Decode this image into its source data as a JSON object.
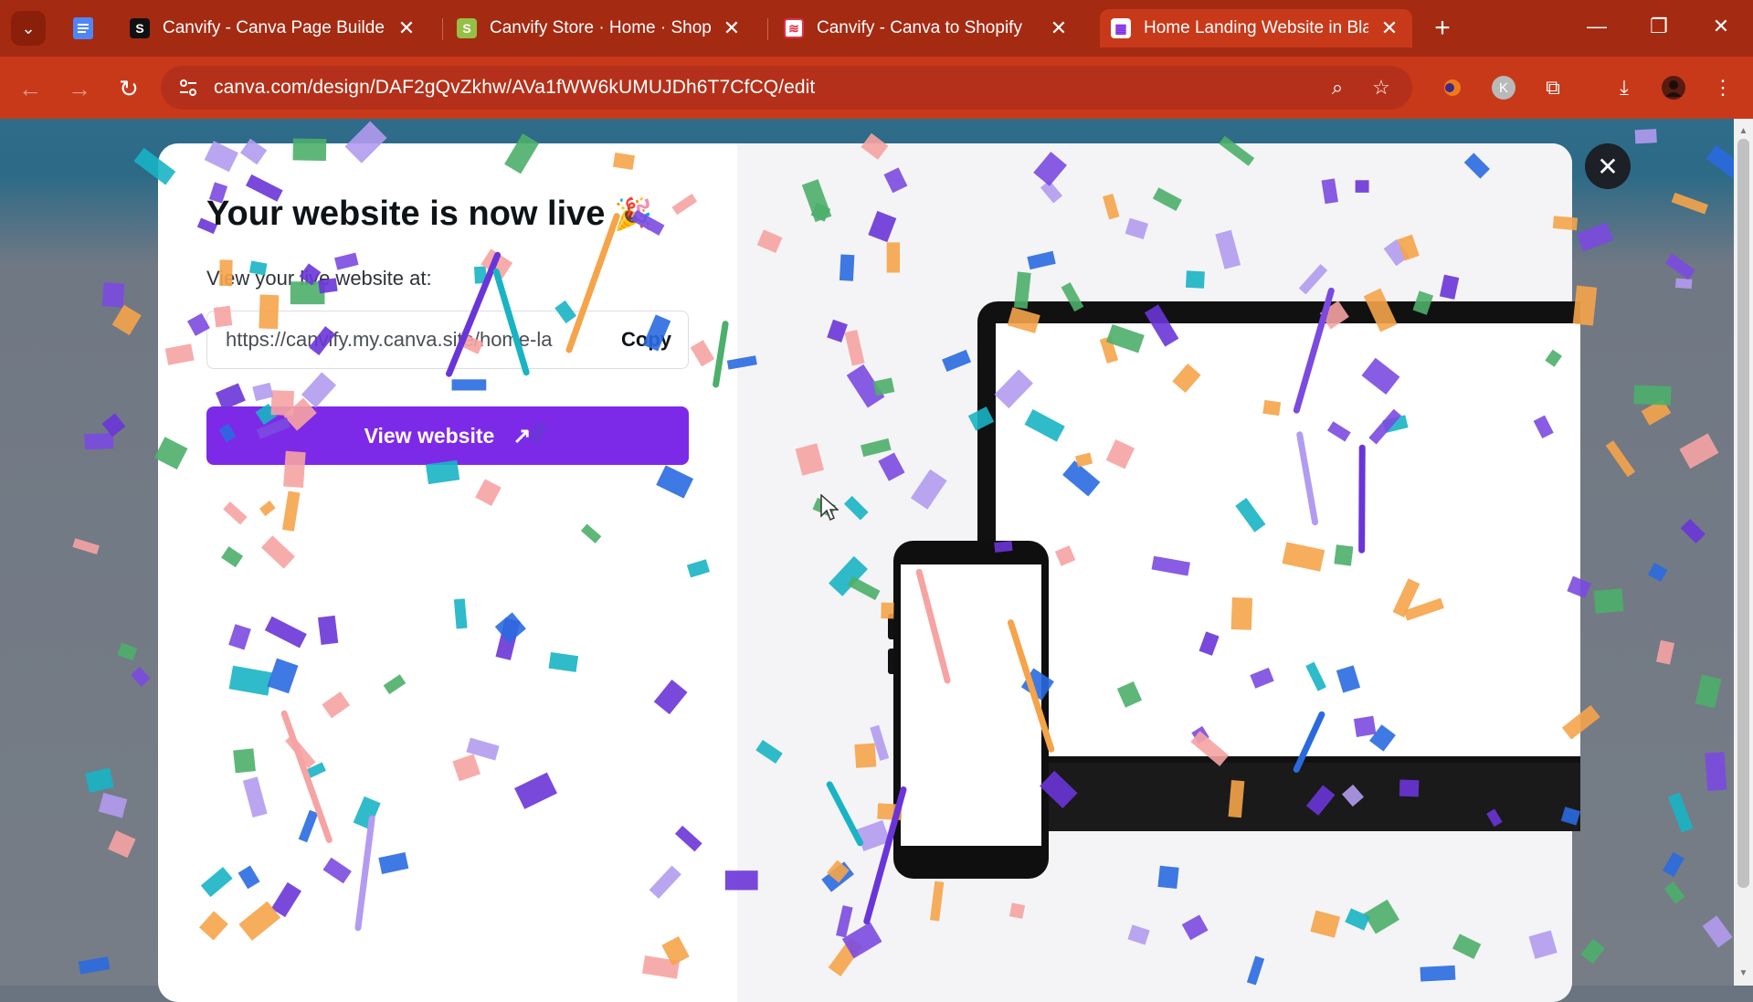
{
  "browser": {
    "tabs": [
      {
        "title": "Canvify - Canva Page Builder - |",
        "favicon": "squarespace-s",
        "active": false
      },
      {
        "title": "Canvify Store · Home · Shopify",
        "favicon": "shopify-bag",
        "active": false
      },
      {
        "title": "Canvify - Canva to Shopify",
        "favicon": "canvify-logo",
        "active": false
      },
      {
        "title": "Home Landing Website in Black",
        "favicon": "canva-calendar",
        "active": true
      }
    ],
    "address": "canva.com/design/DAF2gQvZkhw/AVa1fWW6kUMUJDh6T7CfCQ/edit",
    "profile_initial": "K"
  },
  "modal": {
    "headline": "Your website is now live",
    "headline_emoji": "🎉",
    "sublabel": "View your live website at:",
    "site_url": "https://canvify.my.canva.site/home-la",
    "copy_label": "Copy",
    "cta_label": "View website",
    "cta_icon": "arrow-up-right-icon"
  },
  "colors": {
    "chrome_tabbar": "#a52a12",
    "chrome_toolbar": "#c8391a",
    "cta": "#7d2ae8",
    "confetti": [
      "#7b4ae0",
      "#2a6ae0",
      "#18b4c4",
      "#f5a44a",
      "#f6a3a3",
      "#4caf6a",
      "#b39bf0",
      "#6a35d8"
    ]
  }
}
